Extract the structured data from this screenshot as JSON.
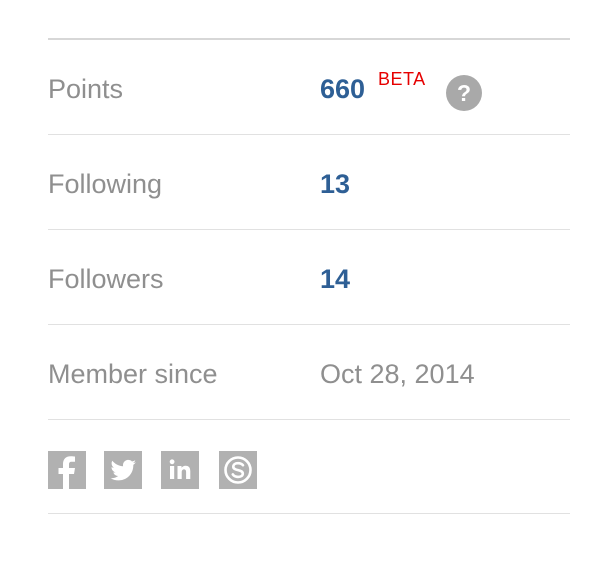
{
  "stats": [
    {
      "label": "Points",
      "value": "660",
      "badge": "BETA",
      "help_glyph": "?"
    },
    {
      "label": "Following",
      "value": "13"
    },
    {
      "label": "Followers",
      "value": "14"
    },
    {
      "label": "Member since",
      "value": "Oct 28, 2014"
    }
  ],
  "social": [
    {
      "name": "facebook",
      "icon": "facebook-icon"
    },
    {
      "name": "twitter",
      "icon": "twitter-icon"
    },
    {
      "name": "linkedin",
      "icon": "linkedin-icon"
    },
    {
      "name": "skype",
      "icon": "skype-icon"
    }
  ],
  "colors": {
    "label": "#8f8f8f",
    "value": "#2e5f95",
    "beta": "#e60000",
    "icon": "#b1b1b1",
    "divider": "#e1e1e1"
  }
}
